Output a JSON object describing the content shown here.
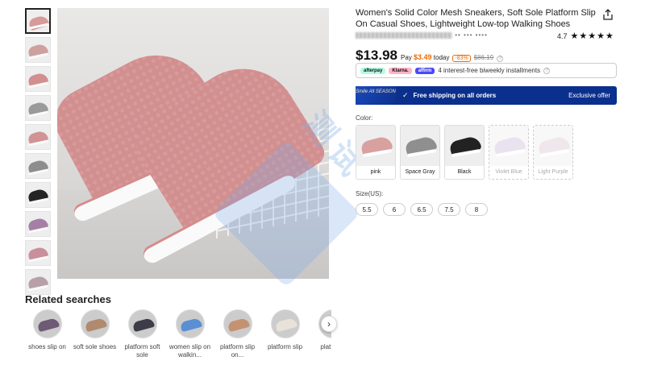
{
  "product": {
    "title": "Women's Solid Color Mesh Sneakers, Soft Sole Platform Slip On Casual Shoes, Lightweight Low-top Walking Shoes",
    "store_suffix": "•• ••• ••••",
    "rating": "4.7",
    "stars": "★★★★★"
  },
  "price": {
    "current": "$13.98",
    "pay_prefix": "Pay",
    "pay_amount": "$3.49",
    "pay_suffix": "today",
    "discount": "-83%",
    "original": "$86.19",
    "info_icon": "?"
  },
  "installments": {
    "providers": [
      "afterpay",
      "Klarna.",
      "affirm"
    ],
    "text": "4 interest-free biweekly installments"
  },
  "shipping": {
    "badge": "Smile All SEASON",
    "check": "✓",
    "text": "Free shipping on all orders",
    "exclusive": "Exclusive offer"
  },
  "color": {
    "label": "Color:",
    "options": [
      {
        "name": "pink",
        "color": "#d9a0a0",
        "disabled": false
      },
      {
        "name": "Space Gray",
        "color": "#8f8f8f",
        "disabled": false
      },
      {
        "name": "Black",
        "color": "#222222",
        "disabled": false
      },
      {
        "name": "Violet Blue",
        "color": "#c9b8d8",
        "disabled": true
      },
      {
        "name": "Light Purple",
        "color": "#d7c4cf",
        "disabled": true
      }
    ]
  },
  "size": {
    "label": "Size(US):",
    "options": [
      "5.5",
      "6",
      "6.5",
      "7.5",
      "8"
    ]
  },
  "thumbnails": [
    {
      "color": "#d69a9a"
    },
    {
      "color": "#cfa0a0"
    },
    {
      "color": "#d38f8f"
    },
    {
      "color": "#9a9a9a"
    },
    {
      "color": "#d09494"
    },
    {
      "color": "#8d8d8d"
    },
    {
      "color": "#242424"
    },
    {
      "color": "#a57fa6"
    },
    {
      "color": "#c98f9a"
    },
    {
      "color": "#b8a0a8"
    }
  ],
  "related": {
    "title": "Related searches",
    "items": [
      {
        "label": "shoes slip on",
        "color": "#6d5a74"
      },
      {
        "label": "soft sole shoes",
        "color": "#b08a6e"
      },
      {
        "label": "platform soft sole",
        "color": "#3d3d4a"
      },
      {
        "label": "women slip on walkin...",
        "color": "#5b8fd4"
      },
      {
        "label": "platform slip on...",
        "color": "#c49270"
      },
      {
        "label": "platform slip",
        "color": "#e8e2d8"
      },
      {
        "label": "platf sho",
        "color": "#a0724e"
      }
    ],
    "next": "›"
  },
  "watermark": "测试"
}
